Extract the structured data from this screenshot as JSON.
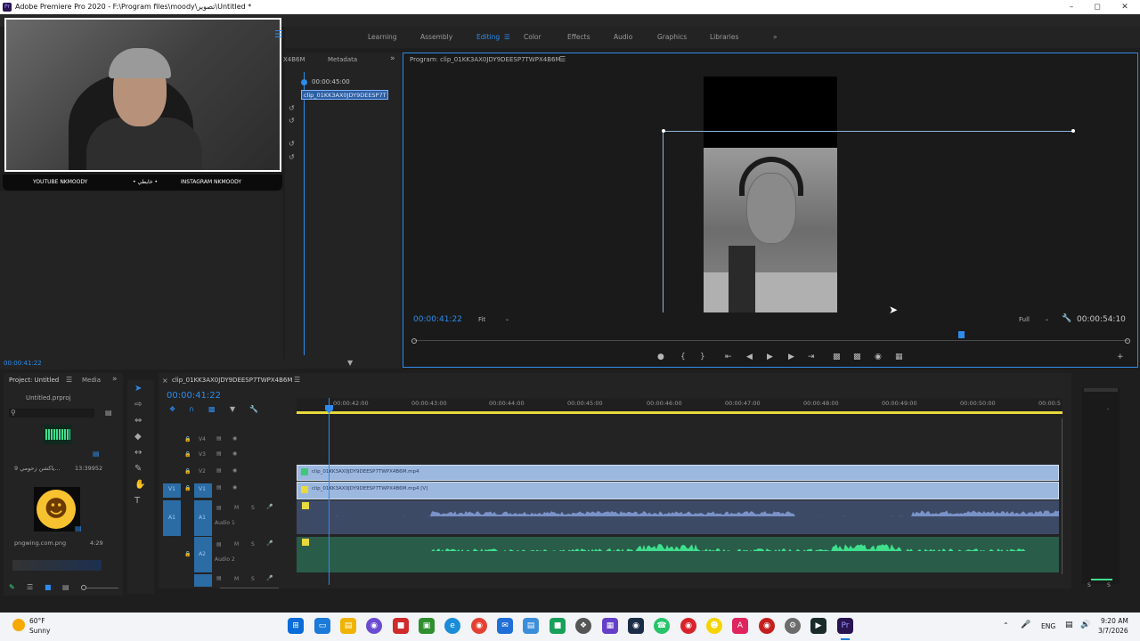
{
  "window": {
    "title": "Adobe Premiere Pro 2020 - F:\\Program files\\moody\\تصوير\\Untitled *",
    "app_icon": "Pr"
  },
  "workspaces": {
    "items": [
      "Learning",
      "Assembly",
      "Editing",
      "Color",
      "Effects",
      "Audio",
      "Graphics",
      "Libraries"
    ],
    "active": "Editing",
    "more": "»"
  },
  "webcam_overlay": {
    "social_left": "YOUTUBE NKMOODY",
    "social_mid": "• خايطي •",
    "social_right": "INSTAGRAM NKMOODY"
  },
  "source_panel": {
    "tab_partial": "X4B6M",
    "tab_metadata": "Metadata",
    "timecode": "00:00:45:00",
    "clip_label": "clip_01KK3AX0JDY9DEESP7T",
    "bottom_timecode": "00:00:41:22"
  },
  "program_monitor": {
    "title": "Program: clip_01KK3AX0JDY9DEESP7TWPX4B6M",
    "current_tc": "00:00:41:22",
    "fit": "Fit",
    "full": "Full",
    "duration_tc": "00:00:54:10"
  },
  "project": {
    "tab_project": "Project: Untitled",
    "tab_media": "Media",
    "file": "Untitled.prproj",
    "item1_name": "9 ياكشن زحومي...",
    "item1_dur": "13:39952",
    "item2_name": "pngwing.com.png",
    "item2_dur": "4:29"
  },
  "timeline": {
    "sequence": "clip_01KK3AX0JDY9DEESP7TWPX4B6M",
    "timecode": "00:00:41:22",
    "ruler": [
      "00:00:42:00",
      "00:00:43:00",
      "00:00:44:00",
      "00:00:45:00",
      "00:00:46:00",
      "00:00:47:00",
      "00:00:48:00",
      "00:00:49:00",
      "00:00:50:00",
      "00:00:5"
    ],
    "tracks": {
      "v4": "V4",
      "v3": "V3",
      "v2": "V2",
      "v1": "V1",
      "a1": "A1",
      "a2": "A2",
      "audio1": "Audio 1",
      "audio2": "Audio 2",
      "m": "M",
      "s": "S"
    },
    "clip_v2": "clip_01KK3AX0JDY9DEESP7TWPX4B6M.mp4",
    "clip_v1": "clip_01KK3AX0JDY9DEESP7TWPX4B6M.mp4 [V]"
  },
  "taskbar": {
    "weather_temp": "60°F",
    "weather_desc": "Sunny",
    "lang": "ENG",
    "time": "9:20 AM",
    "date": "3/7/2026"
  },
  "colors": {
    "accent": "#2d8ceb",
    "audio1_wave": "#7a92c8",
    "audio2_wave": "#3ee08c",
    "video_clip": "#9cb8de"
  }
}
